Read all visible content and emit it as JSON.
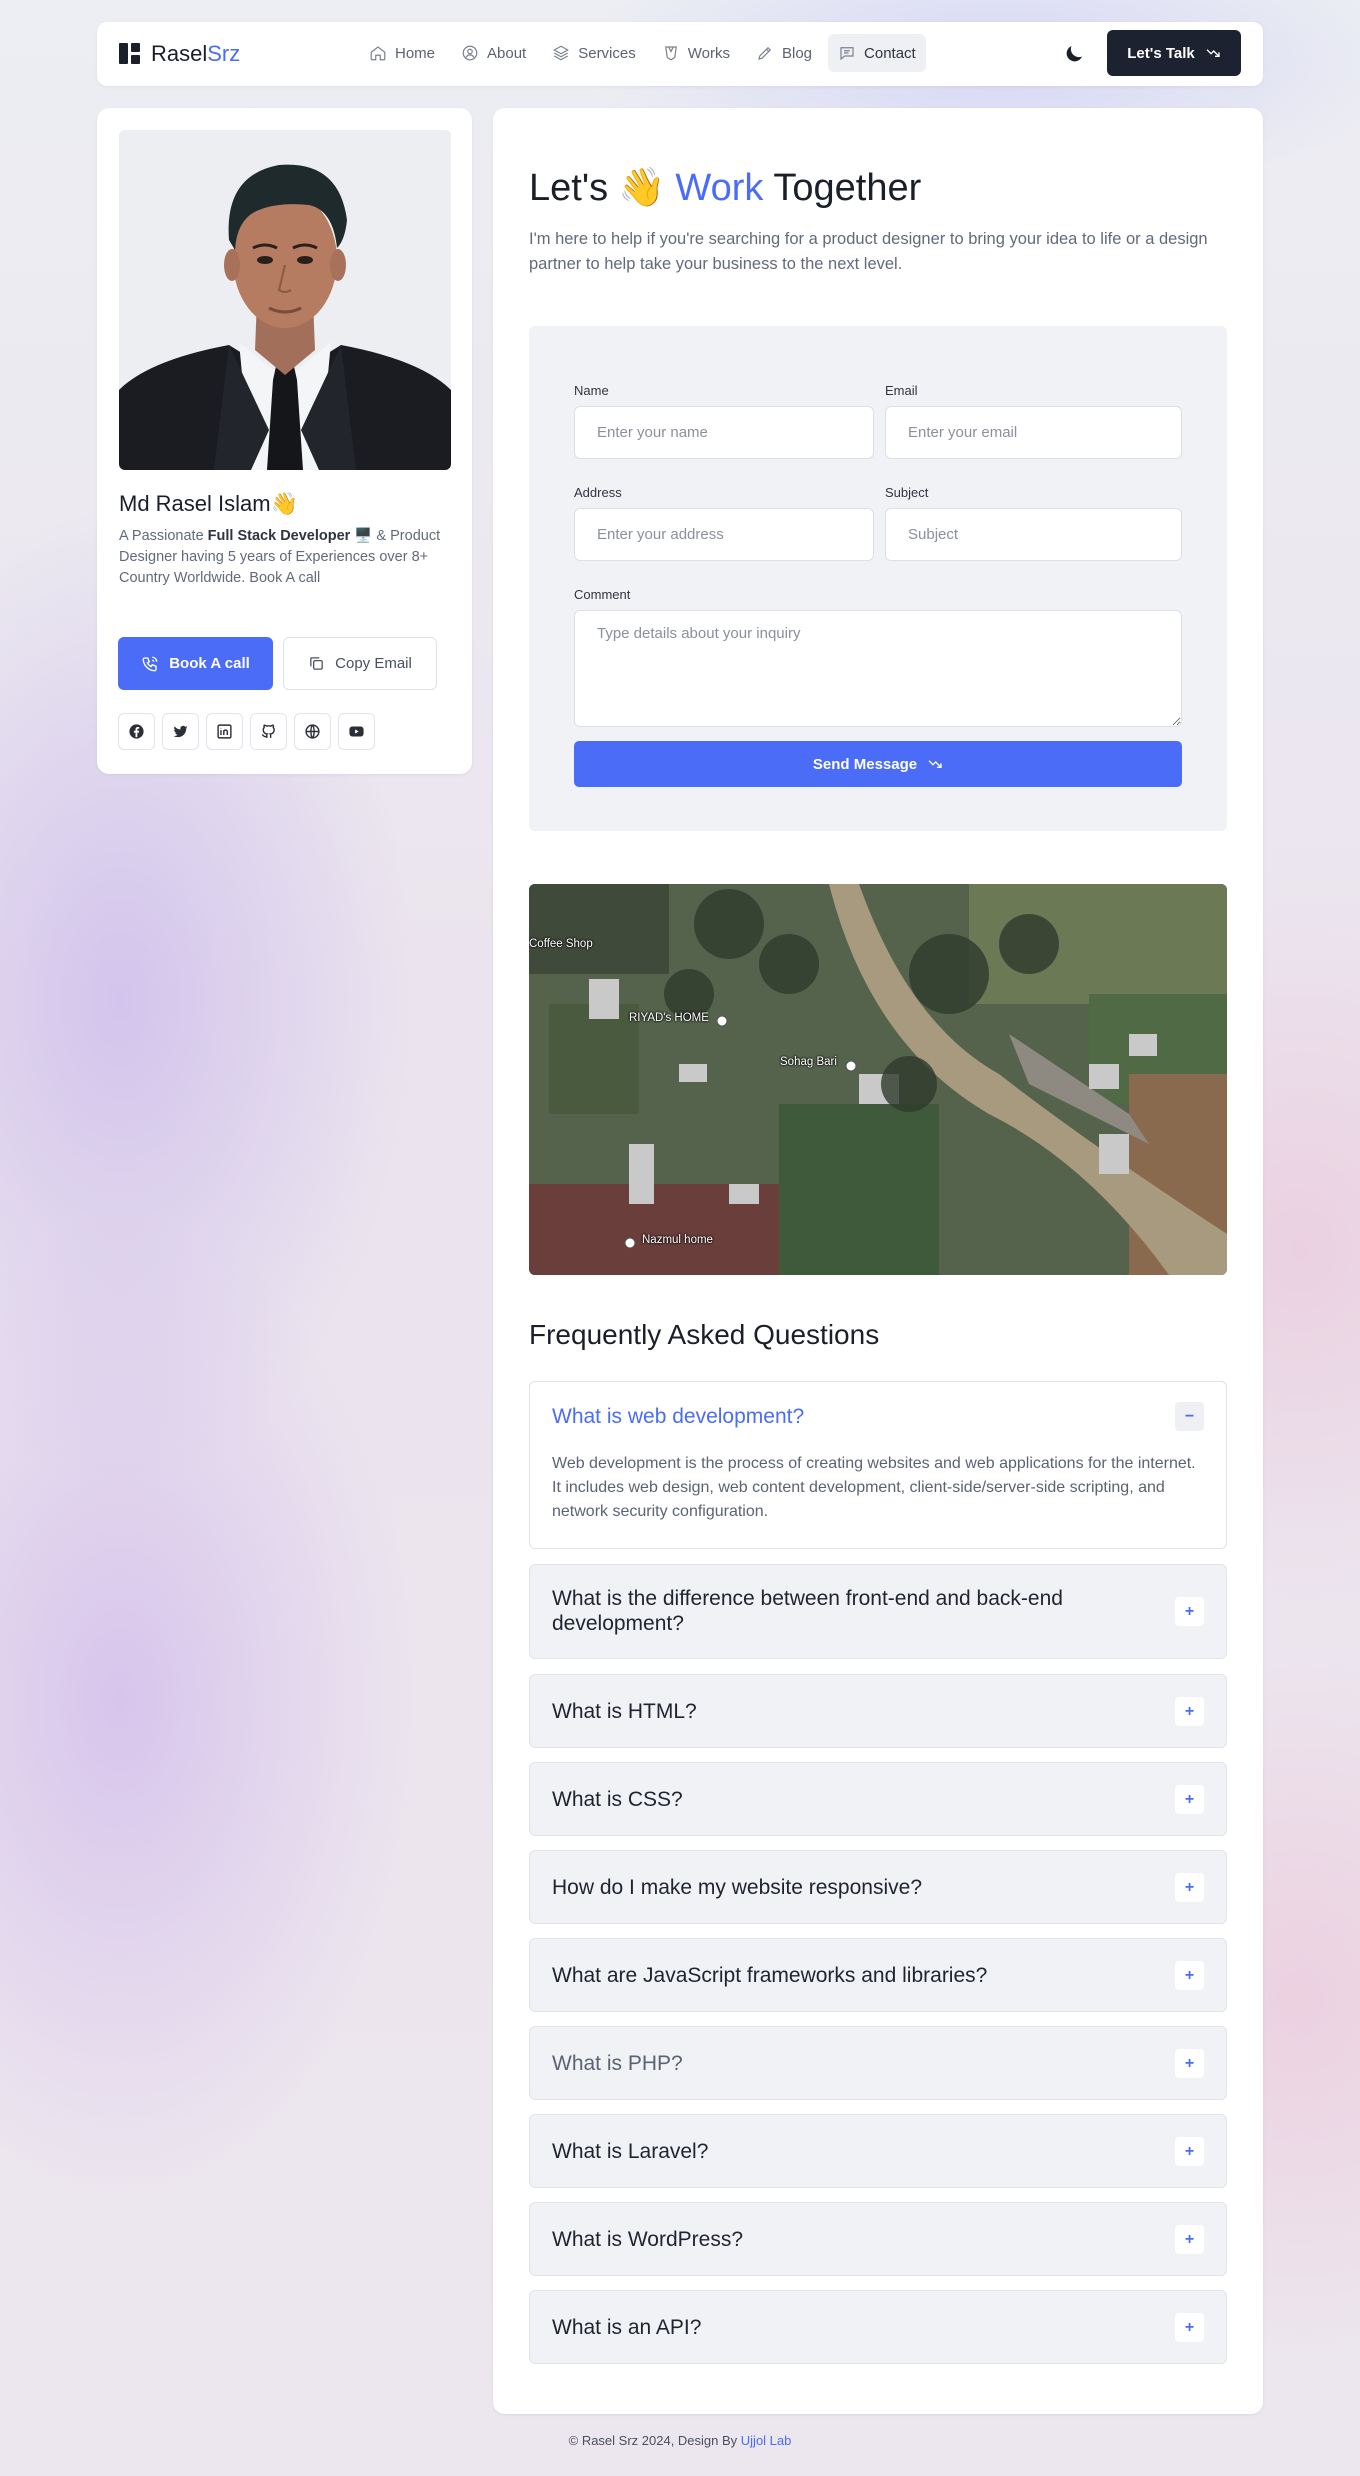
{
  "header": {
    "logo_a": "Rasel",
    "logo_b": "Srz",
    "nav": [
      {
        "label": "Home",
        "icon": "home-icon"
      },
      {
        "label": "About",
        "icon": "user-icon"
      },
      {
        "label": "Services",
        "icon": "layers-icon"
      },
      {
        "label": "Works",
        "icon": "briefcase-icon"
      },
      {
        "label": "Blog",
        "icon": "pen-icon"
      },
      {
        "label": "Contact",
        "icon": "chat-icon",
        "active": true
      }
    ],
    "cta": "Let's Talk"
  },
  "profile": {
    "name": "Md Rasel Islam",
    "bio_a": "A Passionate ",
    "bio_b": "Full Stack Developer",
    "bio_c": " 🖥️ & Product Designer having 5 years of Experiences over 8+ Country Worldwide.  Book A call",
    "book_label": "Book A call",
    "copy_label": "Copy Email",
    "socials": [
      "facebook-icon",
      "twitter-icon",
      "linkedin-icon",
      "github-icon",
      "globe-icon",
      "youtube-icon"
    ]
  },
  "contact": {
    "title_a": "Let's",
    "title_accent": "Work",
    "title_b": "Together",
    "subtitle": "I'm here to help if you're searching for a product designer to bring your idea to life or a design partner to help take your business to the next level.",
    "form": {
      "name_label": "Name",
      "name_placeholder": "Enter your name",
      "email_label": "Email",
      "email_placeholder": "Enter your email",
      "address_label": "Address",
      "address_placeholder": "Enter your address",
      "subject_label": "Subject",
      "subject_placeholder": "Subject",
      "comment_label": "Comment",
      "comment_placeholder": "Type details about your inquiry",
      "submit": "Send Message"
    },
    "map_labels": [
      "Coffee Shop",
      "RIYAD's HOME",
      "Sohag Bari",
      "Nazmul home"
    ]
  },
  "faq": {
    "title": "Frequently Asked Questions",
    "items": [
      {
        "q": "What is web development?",
        "a": "Web development is the process of creating websites and web applications for the internet. It includes web design, web content development, client-side/server-side scripting, and network security configuration.",
        "open": true
      },
      {
        "q": "What is the difference between front-end and back-end development?"
      },
      {
        "q": "What is HTML?"
      },
      {
        "q": "What is CSS?"
      },
      {
        "q": "How do I make my website responsive?"
      },
      {
        "q": "What are JavaScript frameworks and libraries?"
      },
      {
        "q": "What is PHP?"
      },
      {
        "q": "What is Laravel?"
      },
      {
        "q": "What is WordPress?"
      },
      {
        "q": "What is an API?"
      }
    ]
  },
  "footer": {
    "text": "© Rasel Srz 2024, Design By ",
    "link": "Ujjol Lab"
  },
  "colors": {
    "accent": "#4a6cf7",
    "dark": "#1d2230"
  }
}
